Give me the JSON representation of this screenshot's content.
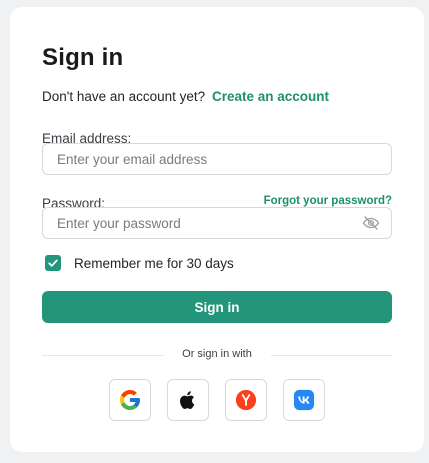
{
  "form": {
    "title": "Sign in",
    "no_account_text": "Don't have an account yet?",
    "create_account_link": "Create an account",
    "email_label": "Email address:",
    "email_placeholder": "Enter your email address",
    "email_value": "",
    "password_label": "Password:",
    "forgot_password_link": "Forgot your password?",
    "password_placeholder": "Enter your password",
    "password_value": "",
    "password_visibility_icon": "eye-slash-icon",
    "remember_label": "Remember me for 30 days",
    "remember_checked": true,
    "submit_label": "Sign in",
    "divider_text": "Or sign in with"
  },
  "social_providers": [
    {
      "name": "Google",
      "icon": "google-icon"
    },
    {
      "name": "Apple",
      "icon": "apple-icon"
    },
    {
      "name": "Yandex",
      "icon": "yandex-icon"
    },
    {
      "name": "VK",
      "icon": "vk-icon"
    }
  ],
  "colors": {
    "accent": "#22957a",
    "link": "#1f8f6f",
    "background": "#f0f1f3",
    "card": "#ffffff"
  }
}
